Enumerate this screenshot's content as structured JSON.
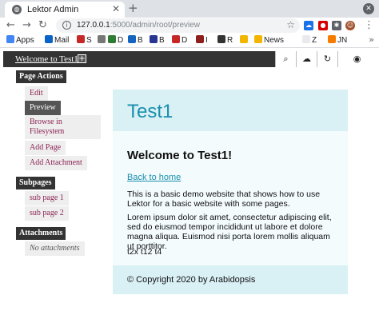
{
  "browser": {
    "tab_title": "Lektor Admin",
    "url_host": "127.0.0.1",
    "url_path": ":5000/admin/root/preview",
    "bookmarks": [
      {
        "label": "Apps",
        "icon": "apps-grid-icon",
        "color": "#4285f4"
      },
      {
        "label": "Mail",
        "icon": "outlook-icon",
        "color": "#0a64c8"
      },
      {
        "label": "S",
        "icon": "s-bookmark-icon",
        "color": "#c62828"
      },
      {
        "label": "",
        "icon": "wiki-icon",
        "color": "#777777"
      },
      {
        "label": "D",
        "icon": "d-bookmark-icon",
        "color": "#2e7d32"
      },
      {
        "label": "B",
        "icon": "b-bookmark-icon",
        "color": "#1565c0"
      },
      {
        "label": "B",
        "icon": "b2-bookmark-icon",
        "color": "#283593"
      },
      {
        "label": "D",
        "icon": "d2-bookmark-icon",
        "color": "#c62828"
      },
      {
        "label": "I",
        "icon": "i-bookmark-icon",
        "color": "#8e1f1f"
      },
      {
        "label": "R",
        "icon": "r-bookmark-icon",
        "color": "#333333"
      },
      {
        "label": "",
        "icon": "folder-icon",
        "color": "#f2b600"
      },
      {
        "label": "News",
        "icon": "news-folder-icon",
        "color": "#f2b600"
      },
      {
        "label": "Z",
        "icon": "z-bookmark-icon",
        "color": "#e8eaed"
      },
      {
        "label": "JN",
        "icon": "jn-bookmark-icon",
        "color": "#f57c00"
      }
    ]
  },
  "header": {
    "title": "Welcome to Test1!",
    "add_label": "+"
  },
  "sidebar": {
    "page_actions_heading": "Page Actions",
    "actions": [
      "Edit",
      "Preview",
      "Browse in Filesystem",
      "Add Page",
      "Add Attachment"
    ],
    "subpages_heading": "Subpages",
    "subpages": [
      "sub page 1",
      "sub page 2"
    ],
    "attachments_heading": "Attachments",
    "attachments_empty": "No attachments"
  },
  "preview": {
    "banner_title": "Test1",
    "heading": "Welcome to Test1!",
    "link": "Back to home",
    "paragraph1": "This is a basic demo website that shows how to use Lektor for a basic website with some pages.",
    "paragraph2": "Lorem ipsum dolor sit amet, consectetur adipiscing elit, sed do eiusmod tempor incididunt ut labore et dolore magna aliqua. Euismod nisi porta lorem mollis aliquam ut porttitor.",
    "tags": "t2x t12 t4",
    "footer": "© Copyright 2020 by Arabidopsis"
  }
}
